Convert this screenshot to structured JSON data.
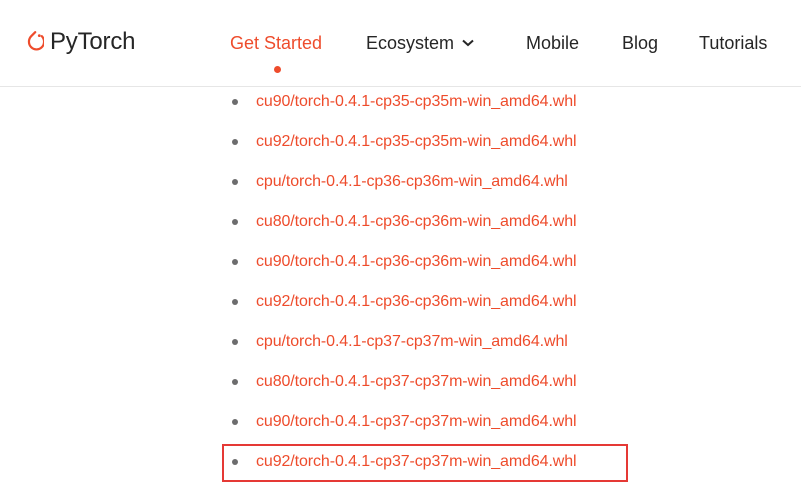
{
  "brand": {
    "name": "PyTorch",
    "accent": "#ee4c2c"
  },
  "nav": {
    "items": [
      {
        "label": "Get Started",
        "active": true
      },
      {
        "label": "Ecosystem",
        "has_dropdown": true
      },
      {
        "label": "Mobile"
      },
      {
        "label": "Blog"
      },
      {
        "label": "Tutorials"
      }
    ]
  },
  "wheels": [
    "cu90/torch-0.4.1-cp35-cp35m-win_amd64.whl",
    "cu92/torch-0.4.1-cp35-cp35m-win_amd64.whl",
    "cpu/torch-0.4.1-cp36-cp36m-win_amd64.whl",
    "cu80/torch-0.4.1-cp36-cp36m-win_amd64.whl",
    "cu90/torch-0.4.1-cp36-cp36m-win_amd64.whl",
    "cu92/torch-0.4.1-cp36-cp36m-win_amd64.whl",
    "cpu/torch-0.4.1-cp37-cp37m-win_amd64.whl",
    "cu80/torch-0.4.1-cp37-cp37m-win_amd64.whl",
    "cu90/torch-0.4.1-cp37-cp37m-win_amd64.whl",
    "cu92/torch-0.4.1-cp37-cp37m-win_amd64.whl"
  ],
  "highlighted_wheel_index": 9
}
